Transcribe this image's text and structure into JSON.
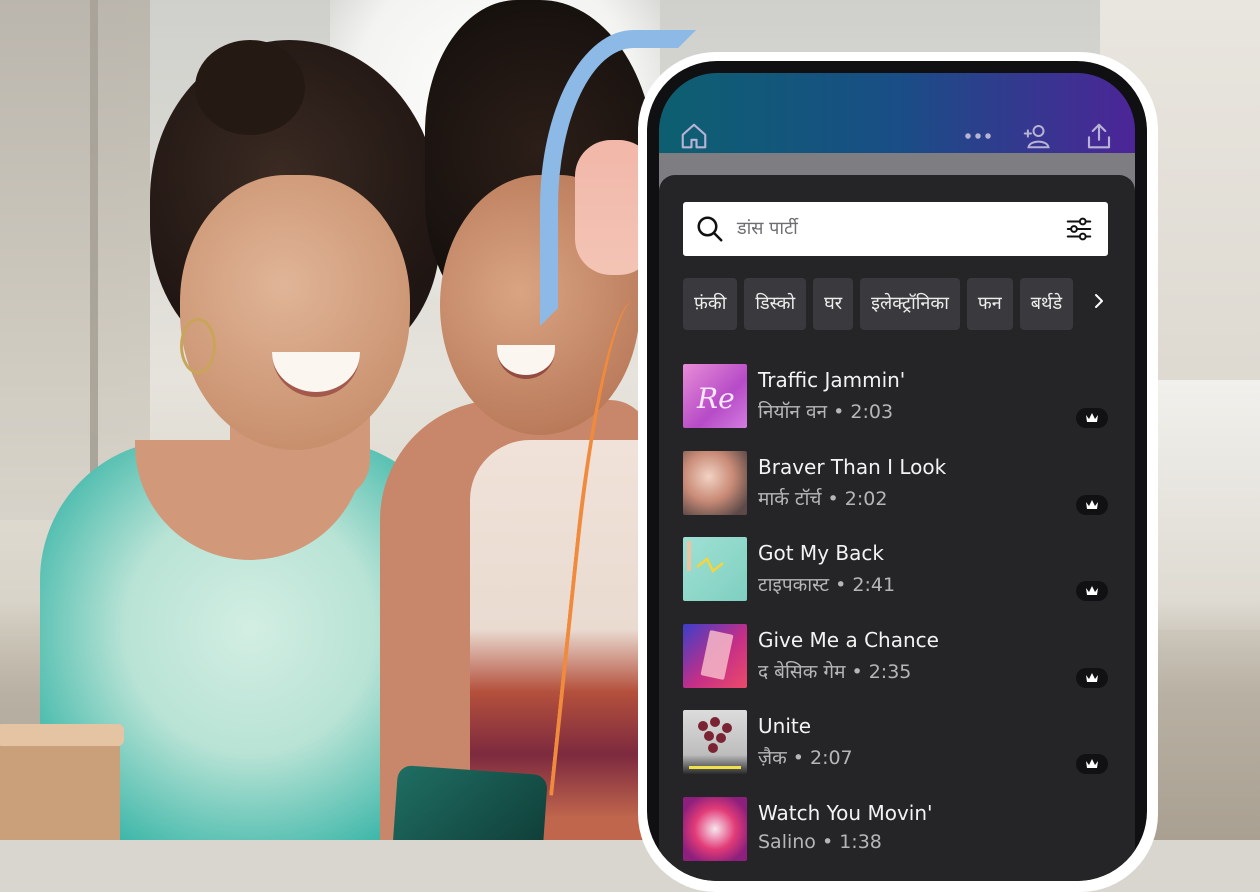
{
  "app": {
    "icons": {
      "home": "home-icon",
      "more": "more-icon",
      "collab": "add-collaborator-icon",
      "share": "share-icon"
    }
  },
  "search": {
    "value": "डांस पार्टी",
    "icon": "search-icon",
    "filter_icon": "filter-icon"
  },
  "chips": [
    "फ़ंकी",
    "डिस्को",
    "घर",
    "इलेक्ट्रॉनिका",
    "फन",
    "बर्थडे"
  ],
  "tracks": [
    {
      "title": "Traffic Jammin'",
      "subtitle": "नियॉन वन • 2:03"
    },
    {
      "title": "Braver Than I Look",
      "subtitle": "मार्क टॉर्च • 2:02"
    },
    {
      "title": "Got My Back",
      "subtitle": "टाइपकास्ट • 2:41"
    },
    {
      "title": "Give Me a Chance",
      "subtitle": "द बेसिक गेम • 2:35"
    },
    {
      "title": "Unite",
      "subtitle": "ज़ैक • 2:07"
    },
    {
      "title": "Watch You Movin'",
      "subtitle": "Salino • 1:38"
    }
  ],
  "colors": {
    "panel": "#252528",
    "chip": "#3a3a3e",
    "gradient_start": "#0d5f70",
    "gradient_end": "#4c2597"
  }
}
